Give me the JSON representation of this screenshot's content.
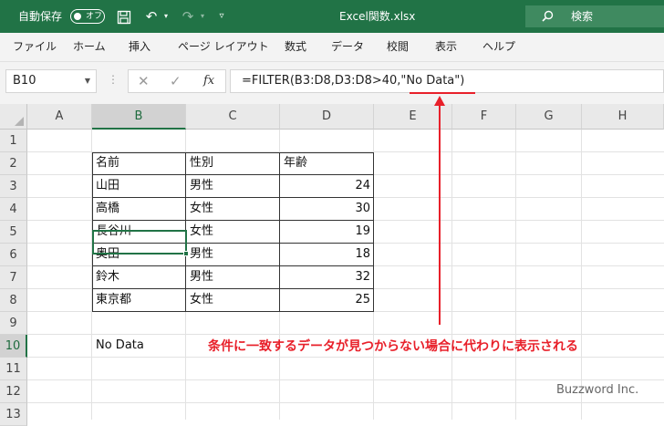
{
  "titlebar": {
    "autosave_label": "自動保存",
    "toggle_text": "オフ",
    "file_name": "Excel関数.xlsx",
    "search_label": "検索",
    "accent_color": "#217346"
  },
  "ribbon": {
    "tabs": [
      "ファイル",
      "ホーム",
      "挿入",
      "ページ レイアウト",
      "数式",
      "データ",
      "校閲",
      "表示",
      "ヘルプ"
    ]
  },
  "formula_bar": {
    "name_box": "B10",
    "formula_prefix": "=FILTER(B3:D8,D3:D8>40,",
    "formula_highlight": "\"No Data\"",
    "formula_suffix": ")"
  },
  "sheet": {
    "columns": [
      "A",
      "B",
      "C",
      "D",
      "E",
      "F",
      "G",
      "H"
    ],
    "selected_column": "B",
    "rows": [
      "1",
      "2",
      "3",
      "4",
      "5",
      "6",
      "7",
      "8",
      "9",
      "10",
      "11",
      "12",
      "13"
    ],
    "selected_row": "10",
    "table_header": [
      "名前",
      "性別",
      "年齢"
    ],
    "table_rows": [
      [
        "山田",
        "男性",
        "24"
      ],
      [
        "高橋",
        "女性",
        "30"
      ],
      [
        "長谷川",
        "女性",
        "19"
      ],
      [
        "奥田",
        "男性",
        "18"
      ],
      [
        "鈴木",
        "男性",
        "32"
      ],
      [
        "東京都",
        "女性",
        "25"
      ]
    ],
    "result_cell": "No Data"
  },
  "annotation": {
    "text": "条件に一致するデータが見つからない場合に代わりに表示される",
    "color": "#e8202a"
  },
  "watermark": "Buzzword Inc."
}
